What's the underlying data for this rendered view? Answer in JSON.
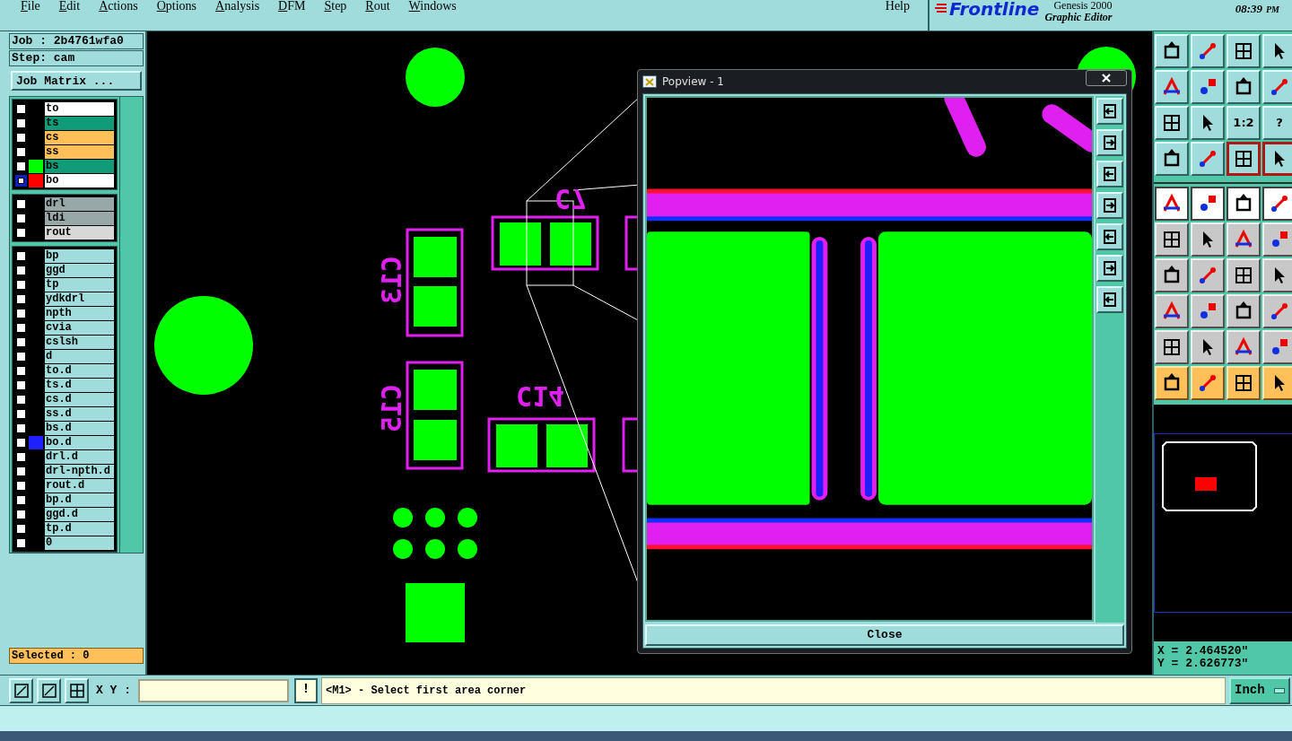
{
  "menu": {
    "items": [
      "File",
      "Edit",
      "Actions",
      "Options",
      "Analysis",
      "DFM",
      "Step",
      "Rout",
      "Windows"
    ],
    "help": "Help"
  },
  "brand": {
    "logo": "Frontline",
    "product": "Genesis 2000",
    "subtitle": "Graphic Editor",
    "time": "08:39",
    "ampm": "PM"
  },
  "job": {
    "job": "Job : 2b4761wfa0",
    "step": "Step: cam",
    "matrix_button": "Job Matrix ..."
  },
  "layer_groups": [
    {
      "layers": [
        {
          "name": "to",
          "kind": "signal",
          "selected": false
        },
        {
          "name": "ts",
          "kind": "mask",
          "selected": false
        },
        {
          "name": "cs",
          "kind": "silk",
          "selected": false
        },
        {
          "name": "ss",
          "kind": "silk",
          "selected": false
        },
        {
          "name": "bs",
          "kind": "mask",
          "color": "#00ff00",
          "selected": false
        },
        {
          "name": "bo",
          "kind": "signal",
          "color": "#ff0000",
          "selected": true
        }
      ]
    },
    {
      "layers": [
        {
          "name": "drl",
          "kind": "drill",
          "selected": false
        },
        {
          "name": "ldi",
          "kind": "drill",
          "selected": false
        },
        {
          "name": "rout",
          "kind": "rout",
          "selected": false
        }
      ]
    },
    {
      "layers": [
        {
          "name": "bp",
          "kind": "document",
          "selected": false
        },
        {
          "name": "ggd",
          "kind": "document",
          "selected": false
        },
        {
          "name": "tp",
          "kind": "document",
          "selected": false
        },
        {
          "name": "ydkdrl",
          "kind": "document",
          "selected": false
        },
        {
          "name": "npth",
          "kind": "document",
          "selected": false
        },
        {
          "name": "cvia",
          "kind": "document",
          "selected": false
        },
        {
          "name": "cslsh",
          "kind": "document",
          "selected": false
        },
        {
          "name": "d",
          "kind": "document",
          "selected": false
        },
        {
          "name": "to.d",
          "kind": "document",
          "selected": false
        },
        {
          "name": "ts.d",
          "kind": "document",
          "selected": false
        },
        {
          "name": "cs.d",
          "kind": "document",
          "selected": false
        },
        {
          "name": "ss.d",
          "kind": "document",
          "selected": false
        },
        {
          "name": "bs.d",
          "kind": "document",
          "selected": false
        },
        {
          "name": "bo.d",
          "kind": "document",
          "color": "#2020ff",
          "selected": false
        },
        {
          "name": "drl.d",
          "kind": "document",
          "selected": false
        },
        {
          "name": "drl-npth.d",
          "kind": "document",
          "selected": false
        },
        {
          "name": "rout.d",
          "kind": "document",
          "selected": false
        },
        {
          "name": "bp.d",
          "kind": "document",
          "selected": false
        },
        {
          "name": "ggd.d",
          "kind": "document",
          "selected": false
        },
        {
          "name": "tp.d",
          "kind": "document",
          "selected": false
        },
        {
          "name": "0",
          "kind": "document",
          "selected": false
        }
      ]
    }
  ],
  "selected_count": "Selected : 0",
  "canvas": {
    "labels": [
      "C7",
      "C13",
      "C15",
      "C14"
    ]
  },
  "popview": {
    "title": "Popview - 1",
    "close_button": "Close"
  },
  "toolbar": {
    "rows": [
      [
        {
          "kind": "cyan"
        },
        {
          "kind": "cyan"
        },
        {
          "kind": "cyan"
        },
        {
          "kind": "cyan"
        }
      ],
      [
        {
          "kind": "cyan"
        },
        {
          "kind": "cyan"
        },
        {
          "kind": "cyan"
        },
        {
          "kind": "cyan"
        }
      ],
      [
        {
          "kind": "cyan"
        },
        {
          "kind": "cyan"
        },
        {
          "kind": "cyan",
          "label": "1:2"
        },
        {
          "kind": "cyan",
          "label": "?"
        }
      ],
      [
        {
          "kind": "cyan"
        },
        {
          "kind": "cyan"
        },
        {
          "kind": "active"
        },
        {
          "kind": "active"
        }
      ],
      [
        {
          "kind": "white"
        },
        {
          "kind": "white"
        },
        {
          "kind": "white"
        },
        {
          "kind": "white"
        }
      ],
      [
        {
          "kind": "gray"
        },
        {
          "kind": "gray"
        },
        {
          "kind": "gray"
        },
        {
          "kind": "gray"
        }
      ],
      [
        {
          "kind": "gray"
        },
        {
          "kind": "gray"
        },
        {
          "kind": "gray"
        },
        {
          "kind": "gray"
        }
      ],
      [
        {
          "kind": "gray"
        },
        {
          "kind": "gray"
        },
        {
          "kind": "gray"
        },
        {
          "kind": "gray"
        }
      ],
      [
        {
          "kind": "gray"
        },
        {
          "kind": "gray"
        },
        {
          "kind": "gray"
        },
        {
          "kind": "gray"
        }
      ],
      [
        {
          "kind": "orange"
        },
        {
          "kind": "orange"
        },
        {
          "kind": "orange"
        },
        {
          "kind": "orange"
        }
      ]
    ]
  },
  "coordinates": {
    "x": "X = 2.464520\"",
    "y": "Y = 2.626773\""
  },
  "command_bar": {
    "xy_label": "X Y :",
    "info_button": "!",
    "message": "<M1> - Select first area corner",
    "units": "Inch"
  }
}
